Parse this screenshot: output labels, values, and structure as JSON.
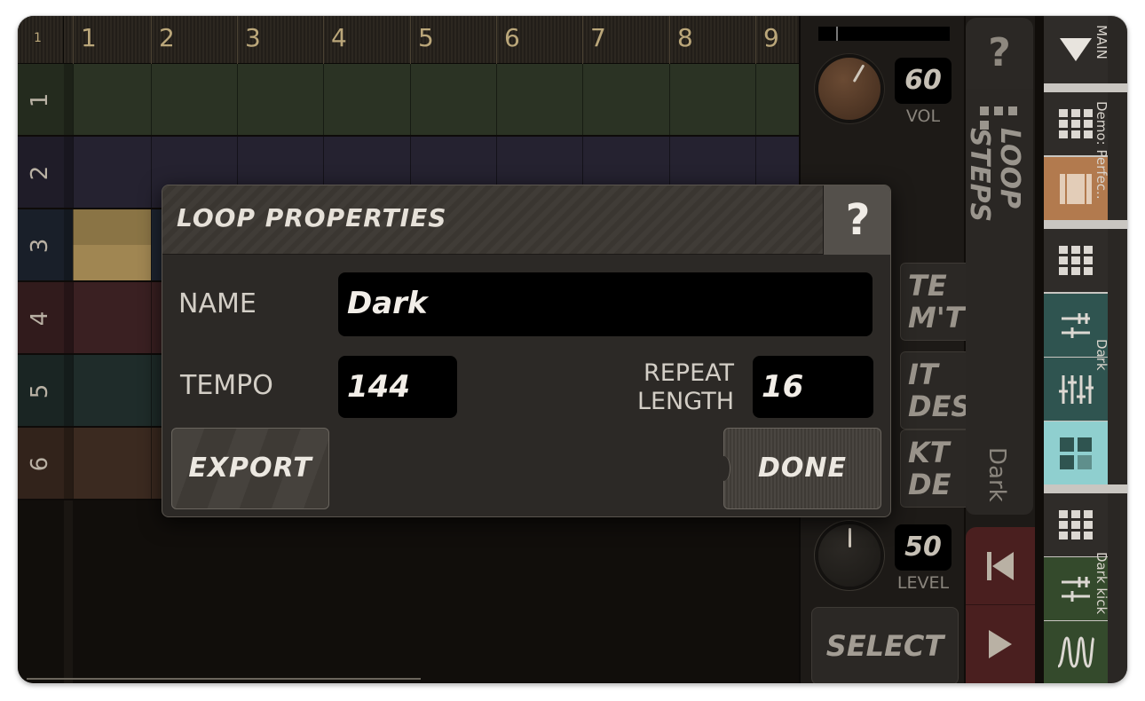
{
  "ruler": {
    "corner": "1",
    "beats": [
      "1",
      "2",
      "3",
      "4",
      "5",
      "6",
      "7",
      "8",
      "9"
    ]
  },
  "tracks": [
    {
      "label": "1",
      "color": "#2b3324"
    },
    {
      "label": "2",
      "color": "#252230"
    },
    {
      "label": "3",
      "color": "#1e2531",
      "highlight": "#8a7445"
    },
    {
      "label": "4",
      "color": "#3a2022"
    },
    {
      "label": "5",
      "color": "#1f2c2a"
    },
    {
      "label": "6",
      "color": "#3b2a20"
    }
  ],
  "panel": {
    "volume": {
      "value": "60",
      "label": "VOL"
    },
    "level": {
      "value": "50",
      "label": "LEVEL"
    },
    "buttons": [
      {
        "line1": "TE",
        "line2": "M'T"
      },
      {
        "line1": "IT",
        "line2": "DES"
      },
      {
        "line1": "KT",
        "line2": "DE"
      }
    ],
    "select_label": "SELECT"
  },
  "steps": {
    "help_label": "?",
    "title_line1": "LOOP",
    "title_line2": "STEPS",
    "loop_name": "Dark"
  },
  "nav": {
    "sections": [
      "MAIN",
      "Demo: Perfec..",
      "Dark",
      "Dark kick"
    ],
    "colors": {
      "dark": "#2f2c29",
      "orange": "#b27a4e",
      "teal": "#2f5450",
      "teal_light": "#8fcfcf",
      "green": "#344a2c"
    }
  },
  "dialog": {
    "title": "LOOP  PROPERTIES",
    "help_label": "?",
    "name_label": "NAME",
    "name_value": "Dark",
    "tempo_label": "TEMPO",
    "tempo_value": "144",
    "repeat_label_1": "REPEAT",
    "repeat_label_2": "LENGTH",
    "repeat_value": "16",
    "export_label": "EXPORT",
    "done_label": "DONE"
  }
}
